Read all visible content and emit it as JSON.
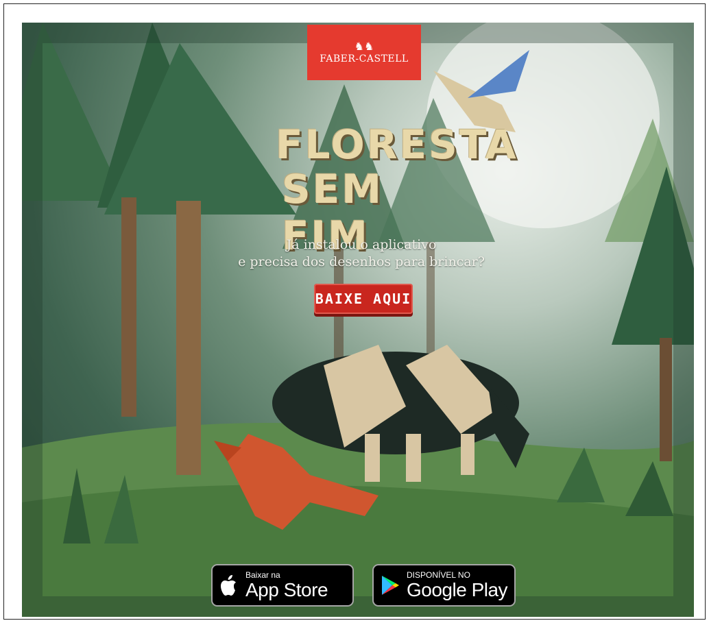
{
  "brand": {
    "name": "FABER-CASTELL",
    "knights_icon": "knights-icon"
  },
  "title": {
    "line1": "FLORESTA",
    "line2": "SEM FIM"
  },
  "subtitle": {
    "line1": "Já instalou o aplicativo",
    "line2": "e precisa dos desenhos para brincar?"
  },
  "cta": {
    "label": "BAIXE AQUI"
  },
  "stores": {
    "apple": {
      "small": "Baixar na",
      "big": "App Store",
      "icon": "apple-icon"
    },
    "google": {
      "small": "DISPONÍVEL NO",
      "big": "Google Play",
      "icon": "google-play-icon"
    }
  },
  "colors": {
    "brand_red": "#e53a2f",
    "cta_red": "#c9261e",
    "forest_dark": "#2b4a3a"
  }
}
